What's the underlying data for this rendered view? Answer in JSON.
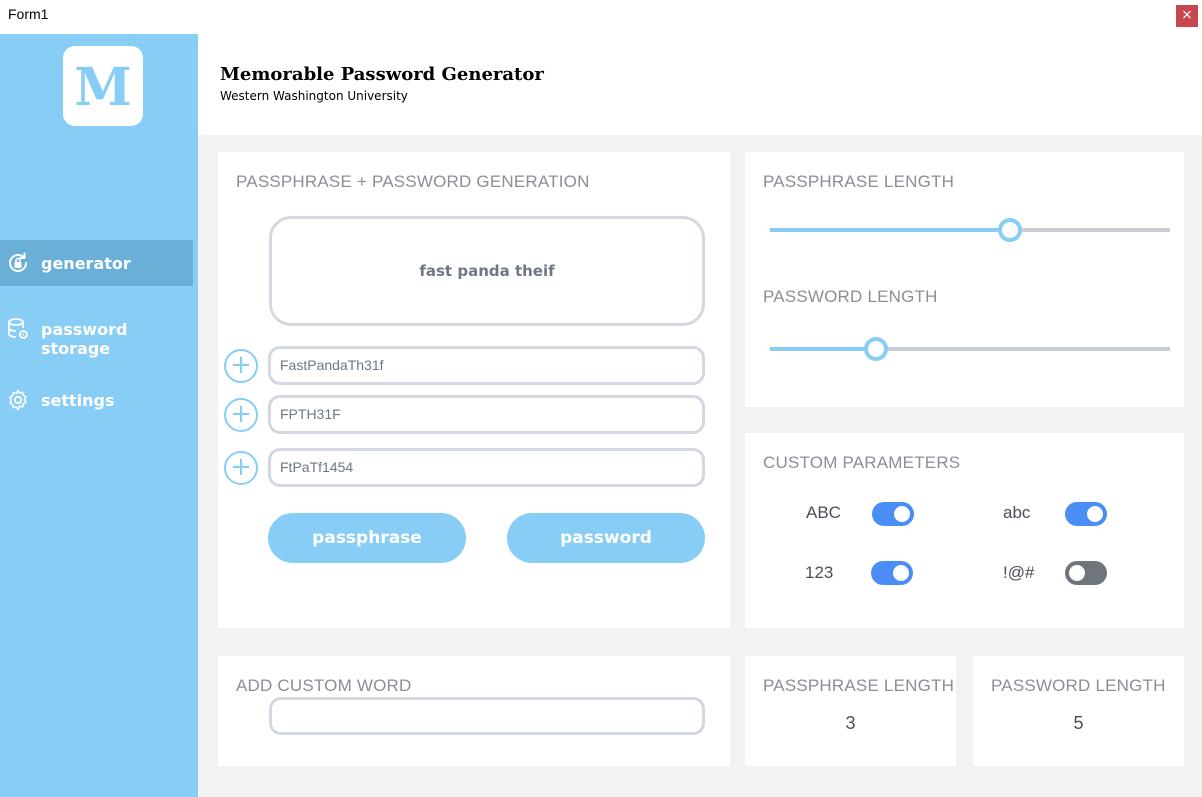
{
  "window": {
    "title": "Form1",
    "close_glyph": "×"
  },
  "sidebar": {
    "logo_letter": "M",
    "items": [
      {
        "label": "generator",
        "icon": "lock-refresh-icon",
        "active": true
      },
      {
        "label": "password storage",
        "icon": "database-icon",
        "active": false
      },
      {
        "label": "settings",
        "icon": "gear-icon",
        "active": false
      }
    ],
    "colors": {
      "background": "#88cdf6",
      "active": "#6aafd8"
    }
  },
  "header": {
    "title": "Memorable Password Generator",
    "subtitle": "Western Washington University"
  },
  "generation": {
    "title": "PASSPHRASE + PASSWORD GENERATION",
    "passphrase": "fast panda theif",
    "passwords": [
      "FastPandaTh31f",
      "FPTH31F",
      "FtPaTf1454"
    ],
    "passphrase_button": "passphrase",
    "password_button": "password"
  },
  "lengths": {
    "passphrase_title": "PASSPHRASE LENGTH",
    "password_title": "PASSWORD LENGTH",
    "passphrase_slider_fraction": 0.6,
    "password_slider_fraction": 0.265
  },
  "params": {
    "title": "CUSTOM PARAMETERS",
    "items": [
      {
        "label": "ABC",
        "on": true
      },
      {
        "label": "abc",
        "on": true
      },
      {
        "label": "123",
        "on": true
      },
      {
        "label": "!@#",
        "on": false
      }
    ],
    "colors": {
      "on": "#4a8df5",
      "off": "#6e757d"
    }
  },
  "custom_word": {
    "title": "ADD CUSTOM WORD",
    "value": ""
  },
  "stats": {
    "passphrase_title": "PASSPHRASE LENGTH",
    "passphrase_value": "3",
    "password_title": "PASSWORD LENGTH",
    "password_value": "5"
  }
}
